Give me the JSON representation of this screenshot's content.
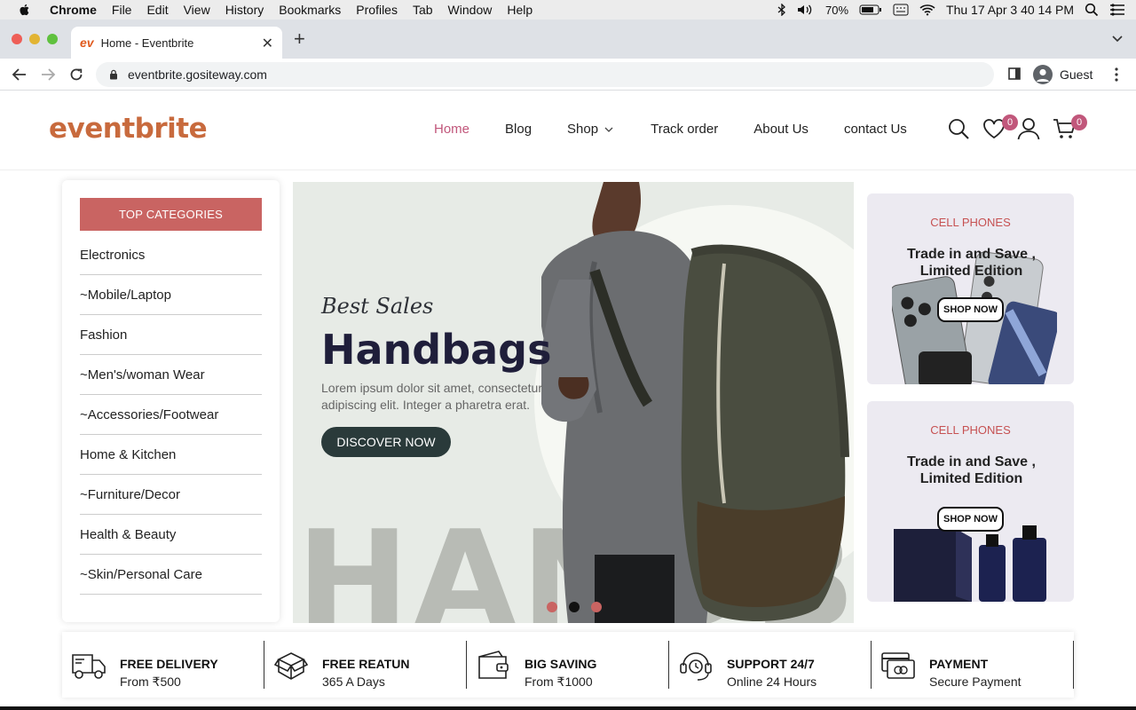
{
  "menubar": {
    "app": "Chrome",
    "items": [
      "File",
      "Edit",
      "View",
      "History",
      "Bookmarks",
      "Profiles",
      "Tab",
      "Window",
      "Help"
    ],
    "battery": "70%",
    "clock": "Thu 17 Apr  3 40 14 PM"
  },
  "browser": {
    "tab_favicon": "ev",
    "tab_title": "Home - Eventbrite",
    "url": "eventbrite.gositeway.com",
    "profile": "Guest"
  },
  "site": {
    "logo": "eventbrite",
    "nav": [
      {
        "label": "Home",
        "active": true
      },
      {
        "label": "Blog"
      },
      {
        "label": "Shop",
        "has_dropdown": true
      },
      {
        "label": "Track order"
      },
      {
        "label": "About Us"
      },
      {
        "label": "contact Us"
      }
    ],
    "wishlist_count": "0",
    "cart_count": "0"
  },
  "sidebar": {
    "heading": "TOP CATEGORIES",
    "categories": [
      "Electronics",
      "~Mobile/Laptop",
      "Fashion",
      "~Men's/woman Wear",
      "~Accessories/Footwear",
      "Home & Kitchen",
      "~Furniture/Decor",
      "Health & Beauty",
      "~Skin/Personal Care"
    ]
  },
  "hero": {
    "eyebrow": "Best Sales",
    "title": "Handbags",
    "description": "Lorem ipsum dolor sit amet, consectetur adipiscing elit. Integer a pharetra erat.",
    "cta": "DISCOVER NOW",
    "background_word": "HANDBA",
    "slides": 3,
    "active_slide": 2
  },
  "promos": [
    {
      "category": "CELL PHONES",
      "headline": "Trade in and Save , Limited Edition",
      "button": "SHOP NOW"
    },
    {
      "category": "CELL PHONES",
      "headline": "Trade in and Save , Limited Edition",
      "button": "SHOP NOW"
    }
  ],
  "features": [
    {
      "icon": "truck-icon",
      "title": "FREE DELIVERY",
      "subtitle": "From ₹500"
    },
    {
      "icon": "box-icon",
      "title": "FREE REATUN",
      "subtitle": "365 A Days"
    },
    {
      "icon": "wallet-icon",
      "title": "BIG SAVING",
      "subtitle": "From ₹1000"
    },
    {
      "icon": "headset-icon",
      "title": "SUPPORT 24/7",
      "subtitle": "Online 24 Hours"
    },
    {
      "icon": "card-icon",
      "title": "PAYMENT",
      "subtitle": "Secure Payment"
    }
  ],
  "colors": {
    "accent": "#c1577b",
    "category_header": "#c96462",
    "logo": "#c86a3d",
    "hero_bg": "#e7ebe6",
    "promo_label": "#c65152"
  }
}
